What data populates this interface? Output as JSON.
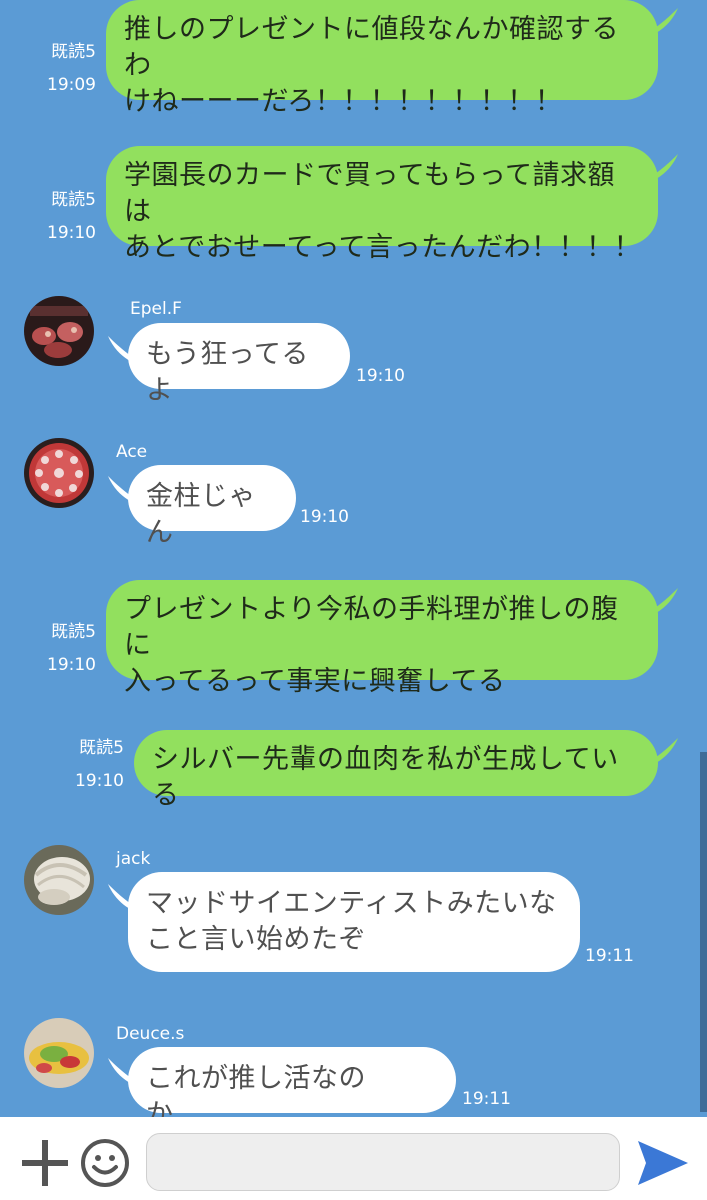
{
  "messages": [
    {
      "read": "既読5",
      "time": "19:09",
      "text": "推しのプレゼントに値段なんか確認するわ\nけねーーーだろ！！！！！！！！！"
    },
    {
      "read": "既読5",
      "time": "19:10",
      "text": "学園長のカードで買ってもらって請求額は\nあとでおせーてって言ったんだわ！！！！"
    },
    {
      "name": "Epel.F",
      "time": "19:10",
      "text": "もう狂ってるよ"
    },
    {
      "name": "Ace",
      "time": "19:10",
      "text": "金柱じゃん"
    },
    {
      "read": "既読5",
      "time": "19:10",
      "text": "プレゼントより今私の手料理が推しの腹に\n入ってるって事実に興奮してる"
    },
    {
      "read": "既読5",
      "time": "19:10",
      "text": "シルバー先輩の血肉を私が生成している"
    },
    {
      "name": "jack",
      "time": "19:11",
      "text": "マッドサイエンティストみたいな\nこと言い始めたぞ"
    },
    {
      "name": "Deuce.s",
      "time": "19:11",
      "text": "これが推し活なのか……."
    }
  ],
  "composer": {
    "plus_icon": "plus-icon",
    "emoji_icon": "smiley-icon",
    "send_icon": "send-arrow-icon",
    "input_value": ""
  },
  "colors": {
    "background": "#5b9bd5",
    "outgoing_bubble": "#92e05e",
    "incoming_bubble": "#ffffff",
    "send_arrow": "#3b78d6"
  }
}
